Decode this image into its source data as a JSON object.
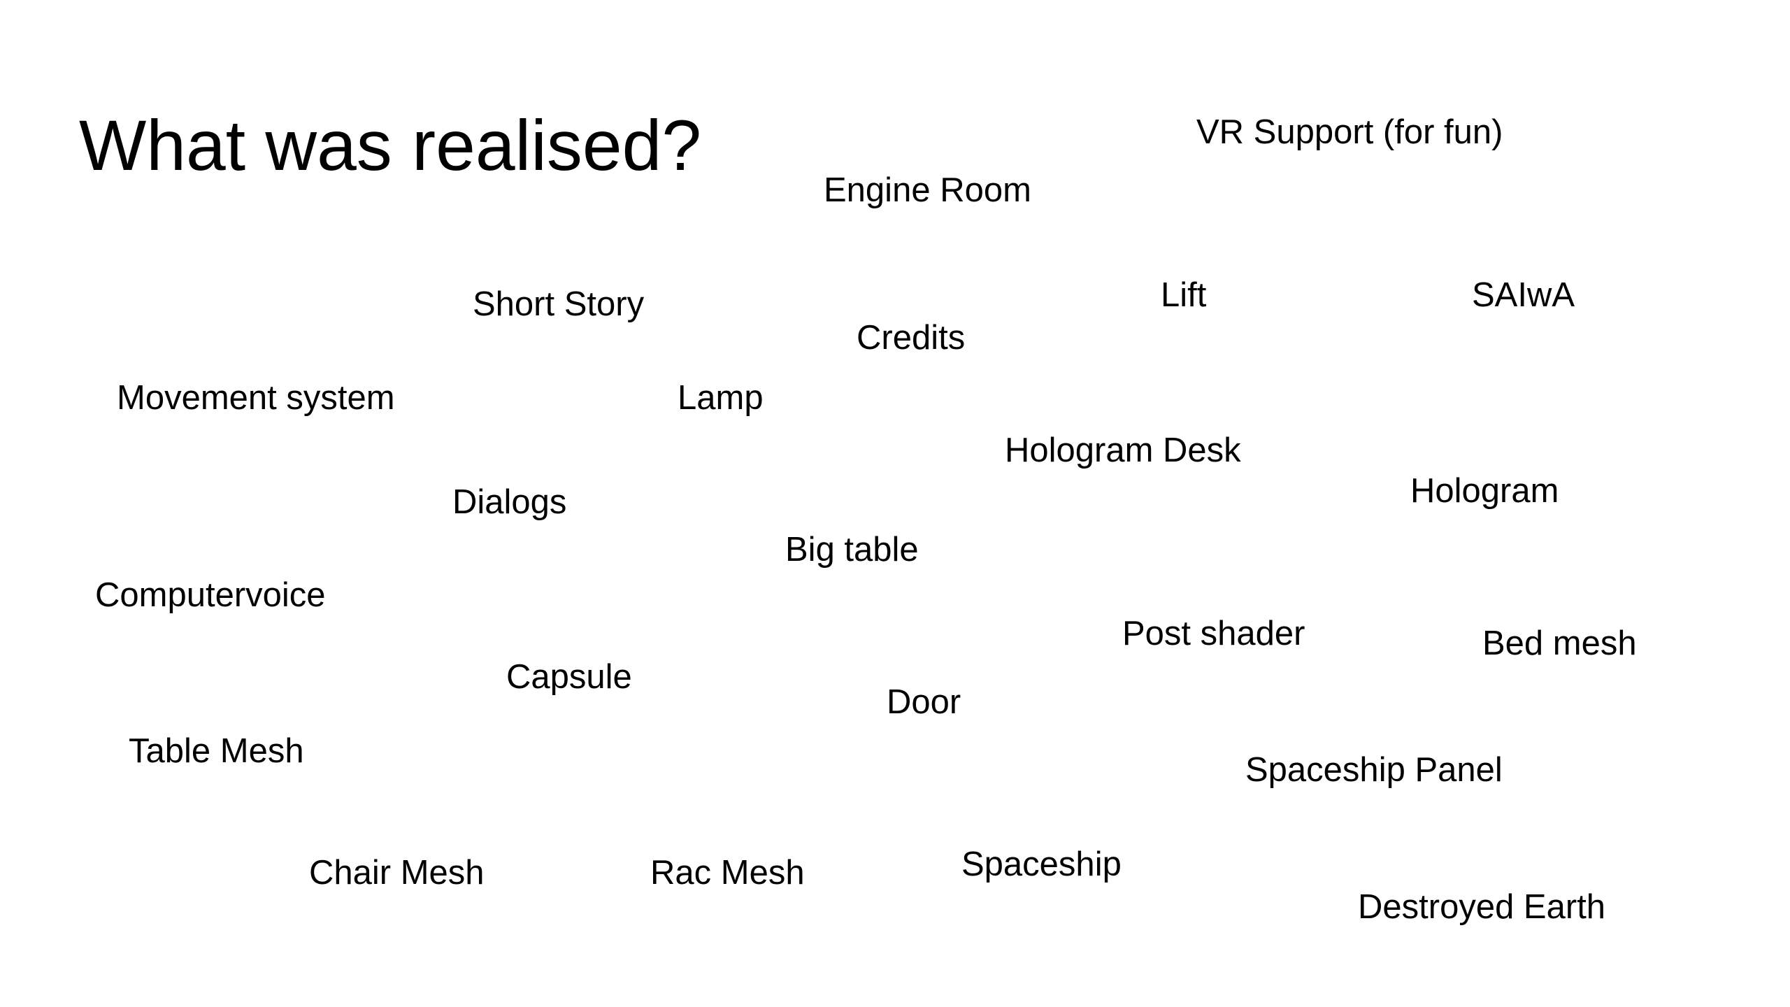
{
  "slide": {
    "title": "What was realised?",
    "items": {
      "vr_support": "VR Support (for fun)",
      "engine_room": "Engine Room",
      "lift": "Lift",
      "saiwa": "SAIwA",
      "short_story": "Short Story",
      "credits": "Credits",
      "movement_system": "Movement system",
      "lamp": "Lamp",
      "hologram_desk": "Hologram Desk",
      "hologram": "Hologram",
      "dialogs": "Dialogs",
      "big_table": "Big table",
      "computervoice": "Computervoice",
      "post_shader": "Post shader",
      "bed_mesh": "Bed mesh",
      "capsule": "Capsule",
      "door": "Door",
      "table_mesh": "Table Mesh",
      "spaceship_panel": "Spaceship Panel",
      "spaceship": "Spaceship",
      "chair_mesh": "Chair Mesh",
      "rac_mesh": "Rac Mesh",
      "destroyed_earth": "Destroyed Earth"
    }
  }
}
